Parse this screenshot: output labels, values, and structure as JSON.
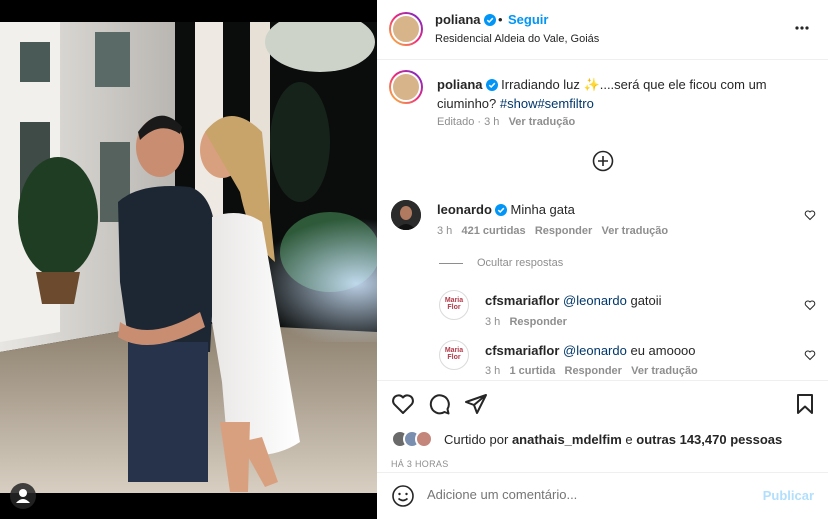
{
  "post": {
    "username": "poliana",
    "dot": "•",
    "follow_label": "Seguir",
    "location": "Residencial Aldeia do Vale, Goiás"
  },
  "caption": {
    "username": "poliana",
    "text_before_emoji": "Irradiando luz ",
    "emoji": "✨",
    "text_after_emoji": "....será que ele ficou com um ciuminho? ",
    "hashtags": "#show#semfiltro",
    "edited": "Editado",
    "time": "3 h",
    "translate": "Ver tradução"
  },
  "comments": [
    {
      "username": "leonardo",
      "text": "Minha gata",
      "time": "3 h",
      "likes": "421 curtidas",
      "reply": "Responder",
      "translate": "Ver tradução"
    }
  ],
  "replies_toggle": "Ocultar respostas",
  "replies": [
    {
      "username": "cfsmariaflor",
      "mention": "@leonardo",
      "text": "gatoii",
      "time": "3 h",
      "reply": "Responder",
      "avatar_text": "Maria Flor"
    },
    {
      "username": "cfsmariaflor",
      "mention": "@leonardo",
      "text": "eu amoooo",
      "time": "3 h",
      "likes": "1 curtida",
      "reply": "Responder",
      "translate": "Ver tradução",
      "avatar_text": "Maria Flor"
    }
  ],
  "likes": {
    "prefix": "Curtido por",
    "user": "anathais_mdelfim",
    "middle": "e",
    "others": "outras 143,470 pessoas"
  },
  "time_ago": "HÁ 3 HORAS",
  "add_comment": {
    "placeholder": "Adicione um comentário...",
    "publish": "Publicar"
  },
  "colors": {
    "accent": "#0095f6",
    "hashtag": "#00376b",
    "muted": "#8e8e8e",
    "publish_disabled": "#b2dffc"
  }
}
